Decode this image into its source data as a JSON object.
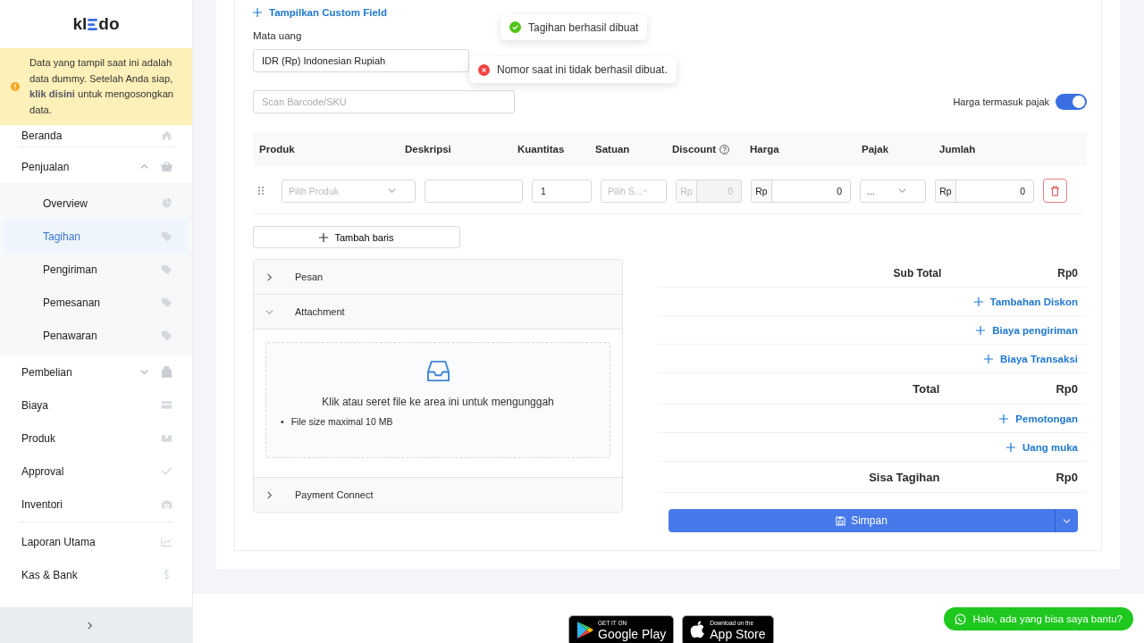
{
  "sidebar": {
    "logo": {
      "left": "kl",
      "right": "do"
    },
    "notice": {
      "before": "Data yang tampil saat ini adalah data dummy. Setelah Anda siap,",
      "link": "klik disini",
      "after": "untuk mengosongkan data."
    },
    "sections": [
      {
        "items": [
          {
            "label": "Beranda",
            "selected": false
          }
        ]
      },
      {
        "items": [
          {
            "label": "Penjualan",
            "selected": false,
            "expanded": true,
            "children": [
              {
                "label": "Overview",
                "selected": false
              },
              {
                "label": "Tagihan",
                "selected": true
              },
              {
                "label": "Pengiriman",
                "selected": false
              },
              {
                "label": "Pemesanan",
                "selected": false
              },
              {
                "label": "Penawaran",
                "selected": false
              }
            ]
          },
          {
            "label": "Pembelian",
            "selected": false,
            "expanded": false
          },
          {
            "label": "Biaya",
            "selected": false
          },
          {
            "label": "Produk",
            "selected": false
          },
          {
            "label": "Approval",
            "selected": false
          },
          {
            "label": "Inventori",
            "selected": false
          }
        ]
      },
      {
        "items": [
          {
            "label": "Laporan Utama",
            "selected": false
          },
          {
            "label": "Kas & Bank",
            "selected": false
          }
        ]
      }
    ]
  },
  "form": {
    "custom_field_link": "Tampilkan Custom Field",
    "currency": {
      "label": "Mata uang",
      "value": "IDR (Rp) Indonesian Rupiah"
    },
    "barcode": {
      "placeholder": "Scan Barcode/SKU"
    },
    "tax_toggle": {
      "label": "Harga termasuk pajak",
      "on": true
    }
  },
  "table": {
    "columns": [
      {
        "label": "Produk"
      },
      {
        "label": "Deskripsi"
      },
      {
        "label": "Kuantitas"
      },
      {
        "label": "Satuan"
      },
      {
        "label": "Discount",
        "help": true
      },
      {
        "label": "Harga"
      },
      {
        "label": "Pajak"
      },
      {
        "label": "Jumlah"
      }
    ],
    "rows": [
      {
        "product_placeholder": "Pilih Produk",
        "description": "",
        "quantity": "1",
        "unit_placeholder": "Pilih S...",
        "discount": {
          "prefix": "Rp",
          "value": "0",
          "disabled": true
        },
        "price": {
          "prefix": "Rp",
          "value": "0"
        },
        "tax": "...",
        "amount": {
          "prefix": "Rp",
          "value": "0"
        }
      }
    ]
  },
  "add_row_button": "Tambah baris",
  "accordion": [
    {
      "title": "Pesan",
      "expanded": false
    },
    {
      "title": "Attachment",
      "expanded": true,
      "upload_hint": "Klik atau seret file ke area ini untuk mengunggah",
      "notes": [
        {
          "marker": "•",
          "text": "File size maximal 10 MB"
        }
      ]
    },
    {
      "title": "Payment Connect",
      "expanded": false
    }
  ],
  "summary": [
    {
      "kind": "subtotal",
      "label": "Sub Total",
      "value": "Rp0"
    },
    {
      "kind": "link",
      "label": "Tambahan Diskon"
    },
    {
      "kind": "link",
      "label": "Biaya pengiriman"
    },
    {
      "kind": "link",
      "label": "Biaya Transaksi"
    },
    {
      "kind": "total",
      "label": "Total",
      "value": "Rp0"
    },
    {
      "kind": "link",
      "label": "Pemotongan"
    },
    {
      "kind": "link",
      "label": "Uang muka"
    },
    {
      "kind": "total",
      "label": "Sisa Tagihan",
      "value": "Rp0"
    }
  ],
  "save_button": "Simpan",
  "toasts": [
    {
      "kind": "success",
      "text": "Tagihan berhasil dibuat"
    },
    {
      "kind": "error",
      "text": "Nomor saat ini tidak berhasil dibuat."
    }
  ],
  "footer": {
    "badges": [
      {
        "kind": "google",
        "small": "GET IT ON",
        "big": "Google Play"
      },
      {
        "kind": "apple",
        "small": "Download on the",
        "big": "App Store"
      }
    ],
    "chat_button": "Halo, ada yang bisa saya bantu?"
  }
}
